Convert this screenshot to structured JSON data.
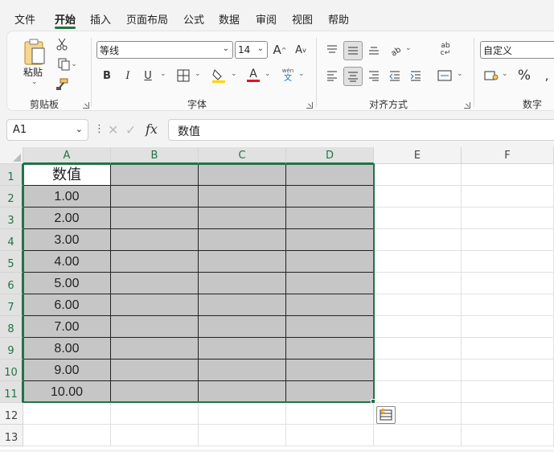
{
  "menu": {
    "tabs": [
      "文件",
      "开始",
      "插入",
      "页面布局",
      "公式",
      "数据",
      "审阅",
      "视图",
      "帮助"
    ],
    "active": "开始"
  },
  "ribbon": {
    "clipboard": {
      "paste_label": "粘贴",
      "group_label": "剪贴板"
    },
    "font": {
      "font_name": "等线",
      "font_size": "14",
      "grow_label": "A",
      "shrink_label": "A",
      "bold": "B",
      "italic": "I",
      "underline": "U",
      "font_color_label": "A",
      "phonetic_top": "wén",
      "phonetic_bottom": "文",
      "group_label": "字体"
    },
    "alignment": {
      "group_label": "对齐方式"
    },
    "number": {
      "format": "自定义",
      "percent": "%",
      "group_label": "数字"
    }
  },
  "formula_bar": {
    "name_box": "A1",
    "fx": "fx",
    "value": "数值"
  },
  "grid": {
    "columns": [
      "A",
      "B",
      "C",
      "D",
      "E",
      "F"
    ],
    "rows": [
      "1",
      "2",
      "3",
      "4",
      "5",
      "6",
      "7",
      "8",
      "9",
      "10",
      "11",
      "12",
      "13"
    ],
    "column_a_values": [
      "数值",
      "1.00",
      "2.00",
      "3.00",
      "4.00",
      "5.00",
      "6.00",
      "7.00",
      "8.00",
      "9.00",
      "10.00"
    ]
  },
  "colors": {
    "accent": "#217346",
    "selection_fill": "#c6c6c6",
    "font_color": "#e81123",
    "highlight": "#ffd400"
  }
}
